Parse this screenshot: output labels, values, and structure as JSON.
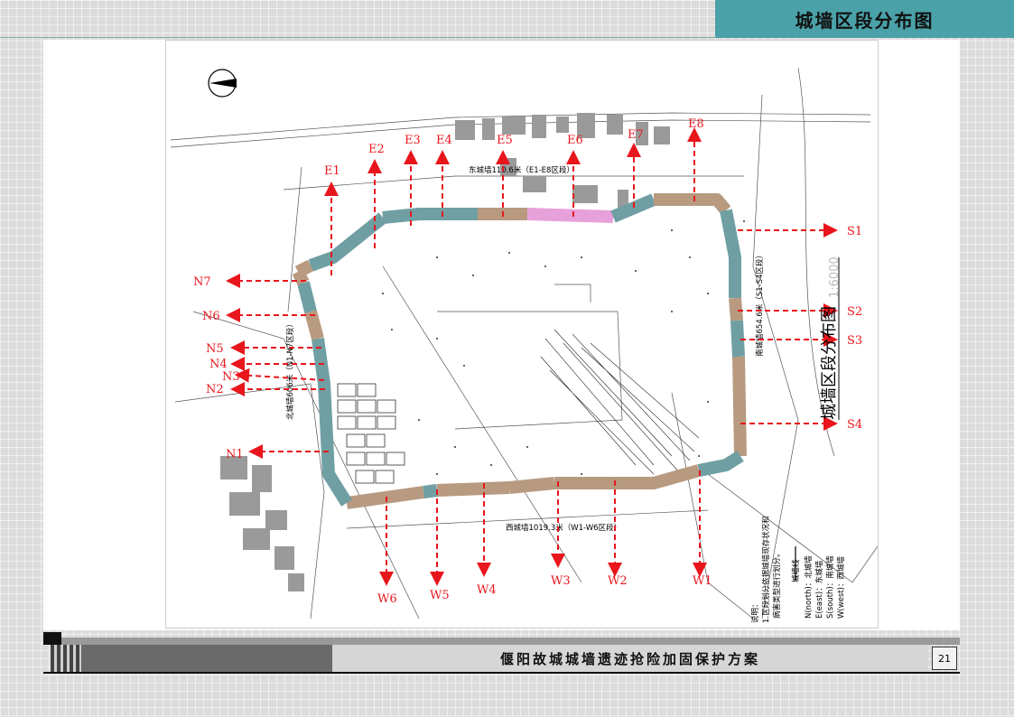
{
  "header": {
    "title": "城墙区段分布图"
  },
  "footer": {
    "project_title": "偃阳故城城墙遗迹抢险加固保护方案",
    "page_number": "21"
  },
  "colors": {
    "accent_teal": "#4aa1a8",
    "wall_teal": "#6f9fa3",
    "wall_brown": "#b89a80",
    "wall_pink": "#e7a1da",
    "arrow_red": "#e8161c"
  },
  "map": {
    "north_arrow": "compass-icon",
    "side_title": "城墙区段分布图",
    "scale_text": "1:6000",
    "wall_labels": {
      "north": "东城墙110.6米（E1-E8区段）",
      "east": "南城墙654.6米（S1-S4区段）",
      "south": "西城墙1019.3米（W1-W6区段）",
      "west": "北城墙606米（N1-N7区段）"
    },
    "section_labels": [
      "E1",
      "E2",
      "E3",
      "E4",
      "E5",
      "E6",
      "E7",
      "E8",
      "S1",
      "S2",
      "S3",
      "S4",
      "W1",
      "W2",
      "W3",
      "W4",
      "W5",
      "W6",
      "N1",
      "N2",
      "N3",
      "N4",
      "N5",
      "N6",
      "N7"
    ],
    "legend": {
      "heading": "说明：",
      "line1": "1.区段划分依据城墙现存状况和",
      "line2": "病害类型进行划分。",
      "key_label": "城墙线",
      "items": [
        "N(north)：北城墙",
        "E(east)：东城墙",
        "S(south)：南城墙",
        "W(west)：西城墙"
      ]
    }
  }
}
